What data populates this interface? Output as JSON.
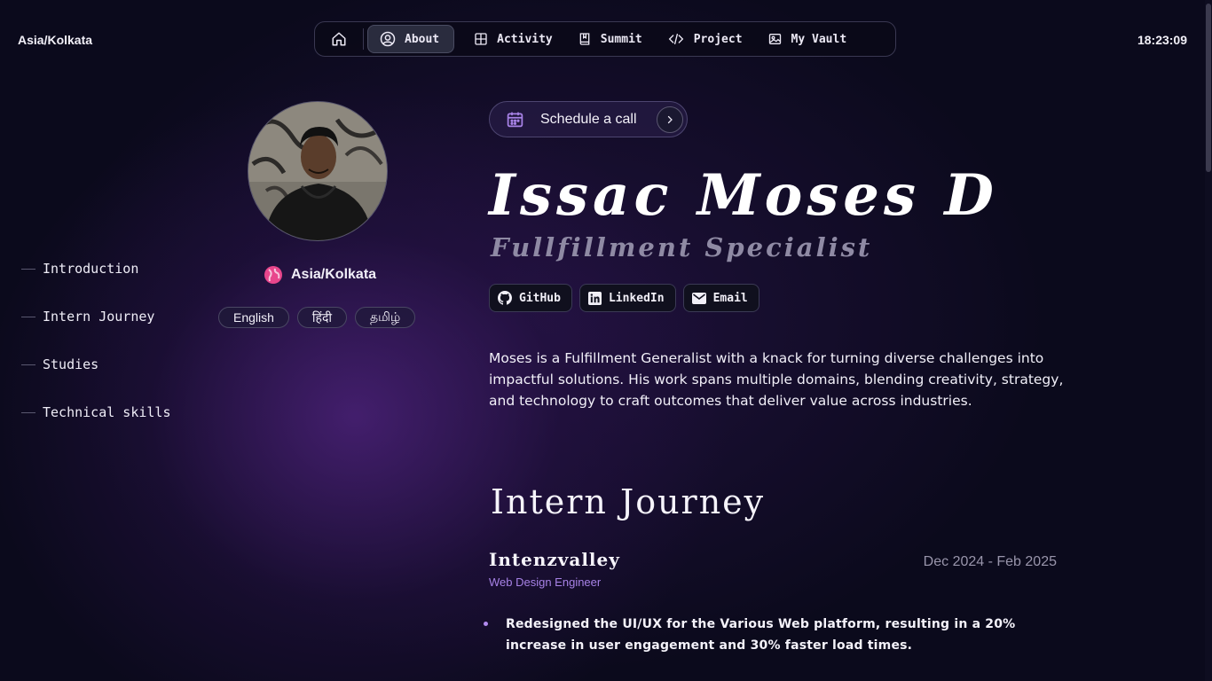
{
  "header": {
    "timezone": "Asia/Kolkata",
    "clock": "18:23:09"
  },
  "nav": {
    "home_icon": "home-icon",
    "items": [
      {
        "label": "About",
        "icon": "user-circle-icon",
        "active": true
      },
      {
        "label": "Activity",
        "icon": "grid-icon"
      },
      {
        "label": "Summit",
        "icon": "book-icon"
      },
      {
        "label": "Project",
        "icon": "code-icon"
      },
      {
        "label": "My Vault",
        "icon": "image-icon"
      }
    ]
  },
  "toc": {
    "items": [
      "Introduction",
      "Intern Journey",
      "Studies",
      "Technical skills"
    ]
  },
  "profile": {
    "location": "Asia/Kolkata",
    "languages": [
      "English",
      "हिंदी",
      "தமிழ்"
    ]
  },
  "cta": {
    "label": "Schedule a call"
  },
  "hero": {
    "name": "Issac Moses D",
    "role": "Fullfillment Specialist",
    "socials": [
      {
        "label": "GitHub",
        "icon": "github-icon"
      },
      {
        "label": "LinkedIn",
        "icon": "linkedin-icon"
      },
      {
        "label": "Email",
        "icon": "mail-icon"
      }
    ],
    "bio": "Moses is a Fulfillment Generalist with a knack for turning diverse challenges into impactful solutions. His work spans multiple domains, blending creativity, strategy, and technology to craft outcomes that deliver value across industries."
  },
  "journey": {
    "title": "Intern Journey",
    "entries": [
      {
        "company": "Intenzvalley",
        "dates": "Dec 2024 - Feb 2025",
        "role": "Web Design Engineer",
        "bullets": [
          "Redesigned the UI/UX for the Various Web platform, resulting in a 20% increase in user engagement and 30% faster load times."
        ]
      }
    ]
  },
  "colors": {
    "accent": "#a782e6",
    "background": "#0b0a1c",
    "globe": "#e8468c"
  }
}
